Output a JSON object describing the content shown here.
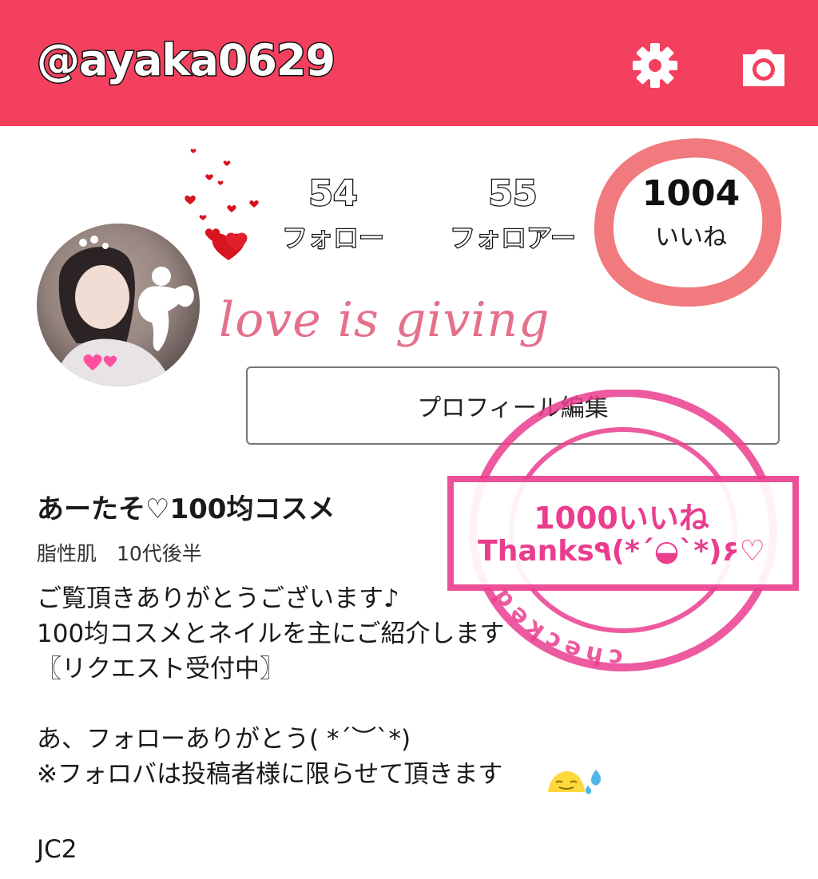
{
  "header": {
    "username": "@ayaka0629",
    "settings_icon": "gear-icon",
    "camera_icon": "camera-icon",
    "color": "#f4405f"
  },
  "stats": {
    "follow": {
      "count": "54",
      "label": "フォロー"
    },
    "follower": {
      "count": "55",
      "label": "フォロアー"
    },
    "likes": {
      "count": "1004",
      "label": "いいね"
    }
  },
  "profile": {
    "motto": "love is giving",
    "edit_button_label": "プロフィール編集",
    "name": "あーたそ♡100均コスメ",
    "sub": "脂性肌　10代後半",
    "bio": "ご覧頂きありがとうございます♪\n100均コスメとネイルを主にご紹介します\n〖リクエスト受付中〗\n\nあ、フォローありがとう( *´︶`*)\n※フォロバは投稿者様に限らせて頂きます",
    "footer": "JC2"
  },
  "stamp": {
    "line1": "1000いいね",
    "line2": "Thanks٩(*´◒`*)۶♡",
    "ring_text": "checked",
    "color": "#ea3d8e"
  }
}
